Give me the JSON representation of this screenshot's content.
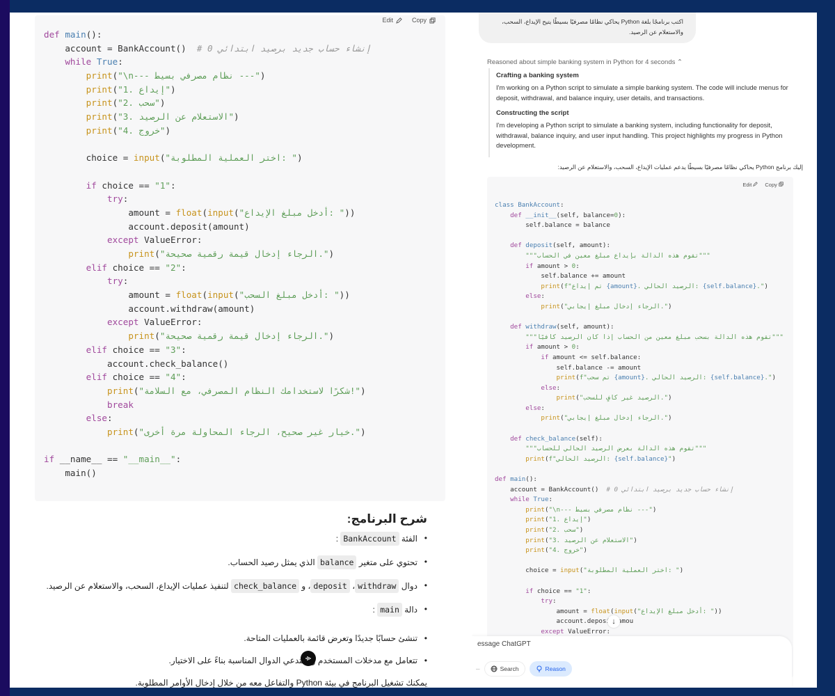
{
  "left_code_block": {
    "edit_label": "Edit",
    "copy_label": "Copy",
    "lines": [
      [
        [
          "kw",
          "def "
        ],
        [
          "fn",
          "main"
        ],
        [
          "",
          "():"
        ]
      ],
      [
        [
          "",
          "    account = BankAccount()  "
        ],
        [
          "cm",
          "# 0 إنشاء حساب جديد برصيد ابتدائي"
        ]
      ],
      [
        [
          "",
          "    "
        ],
        [
          "kw",
          "while "
        ],
        [
          "bool",
          "True"
        ],
        [
          "",
          ":"
        ]
      ],
      [
        [
          "",
          "        "
        ],
        [
          "bi",
          "print"
        ],
        [
          "",
          "("
        ],
        [
          "str",
          "\"\\n--- نظام مصرفي بسيط ---\""
        ],
        [
          "",
          ")"
        ]
      ],
      [
        [
          "",
          "        "
        ],
        [
          "bi",
          "print"
        ],
        [
          "",
          "("
        ],
        [
          "str",
          "\"1. إيداع\""
        ],
        [
          "",
          ")"
        ]
      ],
      [
        [
          "",
          "        "
        ],
        [
          "bi",
          "print"
        ],
        [
          "",
          "("
        ],
        [
          "str",
          "\"2. سحب\""
        ],
        [
          "",
          ")"
        ]
      ],
      [
        [
          "",
          "        "
        ],
        [
          "bi",
          "print"
        ],
        [
          "",
          "("
        ],
        [
          "str",
          "\"3. الاستعلام عن الرصيد\""
        ],
        [
          "",
          ")"
        ]
      ],
      [
        [
          "",
          "        "
        ],
        [
          "bi",
          "print"
        ],
        [
          "",
          "("
        ],
        [
          "str",
          "\"4. خروج\""
        ],
        [
          "",
          ")"
        ]
      ],
      [
        [
          "",
          ""
        ]
      ],
      [
        [
          "",
          "        choice = "
        ],
        [
          "bi",
          "input"
        ],
        [
          "",
          "("
        ],
        [
          "str",
          "\"اختر العملية المطلوبة: \""
        ],
        [
          "",
          ")"
        ]
      ],
      [
        [
          "",
          ""
        ]
      ],
      [
        [
          "",
          "        "
        ],
        [
          "kw",
          "if "
        ],
        [
          "",
          "choice == "
        ],
        [
          "str",
          "\"1\""
        ],
        [
          "",
          ":"
        ]
      ],
      [
        [
          "",
          "            "
        ],
        [
          "kw",
          "try"
        ],
        [
          "",
          ":"
        ]
      ],
      [
        [
          "",
          "                amount = "
        ],
        [
          "bi",
          "float"
        ],
        [
          "",
          "("
        ],
        [
          "bi",
          "input"
        ],
        [
          "",
          "("
        ],
        [
          "str",
          "\"أدخل مبلغ الإيداع: \""
        ],
        [
          "",
          "))"
        ]
      ],
      [
        [
          "",
          "                account.deposit(amount)"
        ]
      ],
      [
        [
          "",
          "            "
        ],
        [
          "kw",
          "except "
        ],
        [
          "",
          "ValueError:"
        ]
      ],
      [
        [
          "",
          "                "
        ],
        [
          "bi",
          "print"
        ],
        [
          "",
          "("
        ],
        [
          "str",
          "\"الرجاء إدخال قيمة رقمية صحيحة.\""
        ],
        [
          "",
          ")"
        ]
      ],
      [
        [
          "",
          "        "
        ],
        [
          "kw",
          "elif "
        ],
        [
          "",
          "choice == "
        ],
        [
          "str",
          "\"2\""
        ],
        [
          "",
          ":"
        ]
      ],
      [
        [
          "",
          "            "
        ],
        [
          "kw",
          "try"
        ],
        [
          "",
          ":"
        ]
      ],
      [
        [
          "",
          "                amount = "
        ],
        [
          "bi",
          "float"
        ],
        [
          "",
          "("
        ],
        [
          "bi",
          "input"
        ],
        [
          "",
          "("
        ],
        [
          "str",
          "\"أدخل مبلغ السحب: \""
        ],
        [
          "",
          "))"
        ]
      ],
      [
        [
          "",
          "                account.withdraw(amount)"
        ]
      ],
      [
        [
          "",
          "            "
        ],
        [
          "kw",
          "except "
        ],
        [
          "",
          "ValueError:"
        ]
      ],
      [
        [
          "",
          "                "
        ],
        [
          "bi",
          "print"
        ],
        [
          "",
          "("
        ],
        [
          "str",
          "\"الرجاء إدخال قيمة رقمية صحيحة.\""
        ],
        [
          "",
          ")"
        ]
      ],
      [
        [
          "",
          "        "
        ],
        [
          "kw",
          "elif "
        ],
        [
          "",
          "choice == "
        ],
        [
          "str",
          "\"3\""
        ],
        [
          "",
          ":"
        ]
      ],
      [
        [
          "",
          "            account.check_balance()"
        ]
      ],
      [
        [
          "",
          "        "
        ],
        [
          "kw",
          "elif "
        ],
        [
          "",
          "choice == "
        ],
        [
          "str",
          "\"4\""
        ],
        [
          "",
          ":"
        ]
      ],
      [
        [
          "",
          "            "
        ],
        [
          "bi",
          "print"
        ],
        [
          "",
          "("
        ],
        [
          "str",
          "\"شكرًا لاستخدامك النظام المصرفي، مع السلامة!\""
        ],
        [
          "",
          ")"
        ]
      ],
      [
        [
          "",
          "            "
        ],
        [
          "kw",
          "break"
        ]
      ],
      [
        [
          "",
          "        "
        ],
        [
          "kw",
          "else"
        ],
        [
          "",
          ":"
        ]
      ],
      [
        [
          "",
          "            "
        ],
        [
          "bi",
          "print"
        ],
        [
          "",
          "("
        ],
        [
          "str",
          "\"خيار غير صحيح، الرجاء المحاولة مرة أخرى.\""
        ],
        [
          "",
          ")"
        ]
      ],
      [
        [
          "",
          ""
        ]
      ],
      [
        [
          "kw",
          "if "
        ],
        [
          "",
          "__name__ == "
        ],
        [
          "str",
          "\"__main__\""
        ],
        [
          "",
          ":"
        ]
      ],
      [
        [
          "",
          "    main()"
        ]
      ]
    ]
  },
  "explanation": {
    "heading": "شرح البرنامج:",
    "items": [
      {
        "before": "الفئة ",
        "code": [
          "BankAccount"
        ],
        "after": " :"
      },
      {
        "before": "تحتوي على متغير ",
        "code": [
          "balance"
        ],
        "after": " الذي يمثل رصيد الحساب."
      },
      {
        "before": "دوال ",
        "code": [
          "withdraw",
          "deposit",
          "check_balance"
        ],
        "after": " لتنفيذ عمليات الإيداع، السحب، والاستعلام عن الرصيد."
      },
      {
        "before": "دالة ",
        "code": [
          "main"
        ],
        "after": " :"
      },
      {
        "before": "تنشئ حسابًا جديدًا وتعرض قائمة بالعمليات المتاحة.",
        "code": [],
        "after": ""
      },
      {
        "before": "تتعامل مع مدخلات المستخدم وتستدعي الدوال المناسبة بناءً على الاختيار.",
        "code": [],
        "after": ""
      }
    ],
    "code_separators": [
      "، ",
      "، و "
    ],
    "final_note": "يمكنك تشغيل البرنامج في بيئة Python والتفاعل معه من خلال إدخال الأوامر المطلوبة."
  },
  "chat": {
    "user_message": "اكتب برنامجًا بلغة Python يحاكي نظامًا مصرفيًا بسيطًا يتيح الإيداع، السحب، والاستعلام عن الرصيد.",
    "reasoned_label": "Reasoned about simple banking system in Python for 4 seconds",
    "reasoning": [
      {
        "title": "Crafting a banking system",
        "text": "I'm working on a Python script to simulate a simple banking system. The code will include menus for deposit, withdrawal, and balance inquiry, user details, and transactions."
      },
      {
        "title": "Constructing the script",
        "text": "I'm developing a Python script to simulate a banking system, including functionality for deposit, withdrawal, balance inquiry, and user input handling. This project highlights my progress in Python development."
      }
    ],
    "intro_line": "إليك برنامج Python يحاكي نظامًا مصرفيًا بسيطًا يدعم عمليات الإيداع، السحب، والاستعلام عن الرصيد:"
  },
  "right_code_block": {
    "edit_label": "Edit",
    "copy_label": "Copy",
    "lines": [
      [
        [
          "fn",
          "class BankAccount"
        ],
        [
          "",
          ":"
        ]
      ],
      [
        [
          "",
          "    "
        ],
        [
          "kw",
          "def "
        ],
        [
          "fn",
          "__init__"
        ],
        [
          "",
          "(self, balance="
        ],
        [
          "num",
          "0"
        ],
        [
          "",
          "):"
        ]
      ],
      [
        [
          "",
          "        self.balance = balance"
        ]
      ],
      [
        [
          "",
          ""
        ]
      ],
      [
        [
          "",
          "    "
        ],
        [
          "kw",
          "def "
        ],
        [
          "fn",
          "deposit"
        ],
        [
          "",
          "(self, amount):"
        ]
      ],
      [
        [
          "",
          "        "
        ],
        [
          "str",
          "\"\"\"تقوم هذه الدالة بإيداع مبلغ معين في الحساب\"\"\""
        ]
      ],
      [
        [
          "",
          "        "
        ],
        [
          "kw",
          "if "
        ],
        [
          "",
          "amount > "
        ],
        [
          "num",
          "0"
        ],
        [
          "",
          ":"
        ]
      ],
      [
        [
          "",
          "            self.balance += amount"
        ]
      ],
      [
        [
          "",
          "            "
        ],
        [
          "bi",
          "print"
        ],
        [
          "",
          "("
        ],
        [
          "str",
          "f\"تم إيداع "
        ],
        [
          "cm2",
          "{amount}"
        ],
        [
          "str",
          ". الرصيد الحالي: "
        ],
        [
          "cm2",
          "{self.balance}"
        ],
        [
          "str",
          ".\""
        ],
        [
          "",
          ")"
        ]
      ],
      [
        [
          "",
          "        "
        ],
        [
          "kw",
          "else"
        ],
        [
          "",
          ":"
        ]
      ],
      [
        [
          "",
          "            "
        ],
        [
          "bi",
          "print"
        ],
        [
          "",
          "("
        ],
        [
          "str",
          "\"الرجاء إدخال مبلغ إيجابي.\""
        ],
        [
          "",
          ")"
        ]
      ],
      [
        [
          "",
          ""
        ]
      ],
      [
        [
          "",
          "    "
        ],
        [
          "kw",
          "def "
        ],
        [
          "fn",
          "withdraw"
        ],
        [
          "",
          "(self, amount):"
        ]
      ],
      [
        [
          "",
          "        "
        ],
        [
          "str",
          "\"\"\"تقوم هذه الدالة بسحب مبلغ معين من الحساب إذا كان الرصيد كافيًا\"\"\""
        ]
      ],
      [
        [
          "",
          "        "
        ],
        [
          "kw",
          "if "
        ],
        [
          "",
          "amount > "
        ],
        [
          "num",
          "0"
        ],
        [
          "",
          ":"
        ]
      ],
      [
        [
          "",
          "            "
        ],
        [
          "kw",
          "if "
        ],
        [
          "",
          "amount <= self.balance:"
        ]
      ],
      [
        [
          "",
          "                self.balance -= amount"
        ]
      ],
      [
        [
          "",
          "                "
        ],
        [
          "bi",
          "print"
        ],
        [
          "",
          "("
        ],
        [
          "str",
          "f\"تم سحب "
        ],
        [
          "cm2",
          "{amount}"
        ],
        [
          "str",
          ". الرصيد الحالي: "
        ],
        [
          "cm2",
          "{self.balance}"
        ],
        [
          "str",
          ".\""
        ],
        [
          "",
          ")"
        ]
      ],
      [
        [
          "",
          "            "
        ],
        [
          "kw",
          "else"
        ],
        [
          "",
          ":"
        ]
      ],
      [
        [
          "",
          "                "
        ],
        [
          "bi",
          "print"
        ],
        [
          "",
          "("
        ],
        [
          "str",
          "\"الرصيد غير كافٍ للسحب.\""
        ],
        [
          "",
          ")"
        ]
      ],
      [
        [
          "",
          "        "
        ],
        [
          "kw",
          "else"
        ],
        [
          "",
          ":"
        ]
      ],
      [
        [
          "",
          "            "
        ],
        [
          "bi",
          "print"
        ],
        [
          "",
          "("
        ],
        [
          "str",
          "\"الرجاء إدخال مبلغ إيجابي.\""
        ],
        [
          "",
          ")"
        ]
      ],
      [
        [
          "",
          ""
        ]
      ],
      [
        [
          "",
          "    "
        ],
        [
          "kw",
          "def "
        ],
        [
          "fn",
          "check_balance"
        ],
        [
          "",
          "(self):"
        ]
      ],
      [
        [
          "",
          "        "
        ],
        [
          "str",
          "\"\"\"تقوم هذه الدالة بعرض الرصيد الحالي للحساب\"\"\""
        ]
      ],
      [
        [
          "",
          "        "
        ],
        [
          "bi",
          "print"
        ],
        [
          "",
          "("
        ],
        [
          "str",
          "f\"الرصيد الحالي: "
        ],
        [
          "cm2",
          "{self.balance}"
        ],
        [
          "str",
          "\""
        ],
        [
          "",
          ")"
        ]
      ],
      [
        [
          "",
          ""
        ]
      ],
      [
        [
          "kw",
          "def "
        ],
        [
          "fn",
          "main"
        ],
        [
          "",
          "():"
        ]
      ],
      [
        [
          "",
          "    account = BankAccount()  "
        ],
        [
          "cm",
          "# 0 إنشاء حساب جديد برصيد ابتدائي"
        ]
      ],
      [
        [
          "",
          "    "
        ],
        [
          "kw",
          "while "
        ],
        [
          "bool",
          "True"
        ],
        [
          "",
          ":"
        ]
      ],
      [
        [
          "",
          "        "
        ],
        [
          "bi",
          "print"
        ],
        [
          "",
          "("
        ],
        [
          "str",
          "\"\\n--- نظام مصرفي بسيط ---\""
        ],
        [
          "",
          ")"
        ]
      ],
      [
        [
          "",
          "        "
        ],
        [
          "bi",
          "print"
        ],
        [
          "",
          "("
        ],
        [
          "str",
          "\"1. إيداع\""
        ],
        [
          "",
          ")"
        ]
      ],
      [
        [
          "",
          "        "
        ],
        [
          "bi",
          "print"
        ],
        [
          "",
          "("
        ],
        [
          "str",
          "\"2. سحب\""
        ],
        [
          "",
          ")"
        ]
      ],
      [
        [
          "",
          "        "
        ],
        [
          "bi",
          "print"
        ],
        [
          "",
          "("
        ],
        [
          "str",
          "\"3. الاستعلام عن الرصيد\""
        ],
        [
          "",
          ")"
        ]
      ],
      [
        [
          "",
          "        "
        ],
        [
          "bi",
          "print"
        ],
        [
          "",
          "("
        ],
        [
          "str",
          "\"4. خروج\""
        ],
        [
          "",
          ")"
        ]
      ],
      [
        [
          "",
          ""
        ]
      ],
      [
        [
          "",
          "        choice = "
        ],
        [
          "bi",
          "input"
        ],
        [
          "",
          "("
        ],
        [
          "str",
          "\"اختر العملية المطلوبة: \""
        ],
        [
          "",
          ")"
        ]
      ],
      [
        [
          "",
          ""
        ]
      ],
      [
        [
          "",
          "        "
        ],
        [
          "kw",
          "if "
        ],
        [
          "",
          "choice == "
        ],
        [
          "str",
          "\"1\""
        ],
        [
          "",
          ":"
        ]
      ],
      [
        [
          "",
          "            "
        ],
        [
          "kw",
          "try"
        ],
        [
          "",
          ":"
        ]
      ],
      [
        [
          "",
          "                amount = "
        ],
        [
          "bi",
          "float"
        ],
        [
          "",
          "("
        ],
        [
          "bi",
          "input"
        ],
        [
          "",
          "("
        ],
        [
          "str",
          "\"أدخل مبلغ الإيداع: \""
        ],
        [
          "",
          "))"
        ]
      ],
      [
        [
          "",
          "                account.deposit(amou"
        ]
      ],
      [
        [
          "",
          "            "
        ],
        [
          "kw",
          "except "
        ],
        [
          "",
          "ValueError:"
        ]
      ]
    ]
  },
  "composer": {
    "placeholder": "Message ChatGPT",
    "value": "essage ChatGPT",
    "search_label": "Search",
    "reason_label": "Reason",
    "reason_active": true,
    "accent_color": "#2563eb"
  },
  "icons": {
    "edit": "edit-icon",
    "copy": "copy-icon",
    "chevron_up": "chevron-up-icon",
    "globe": "globe-icon",
    "bulb": "lightbulb-icon",
    "voice": "voice-waveform-icon",
    "scroll_down": "arrow-down-icon"
  }
}
